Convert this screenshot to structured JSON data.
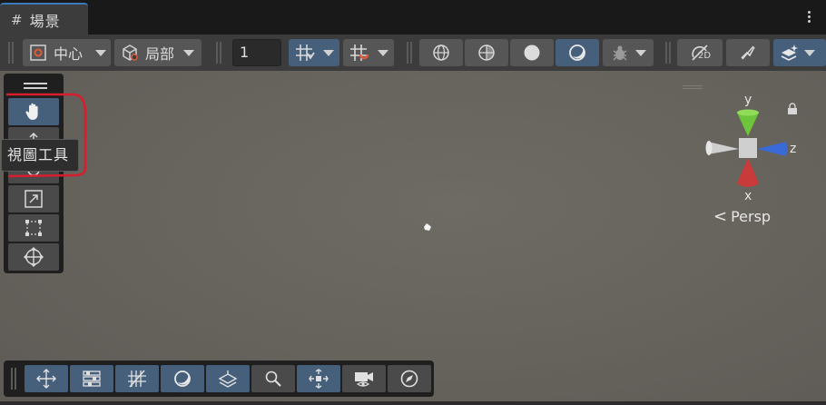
{
  "tab": {
    "icon": "grid-hash-icon",
    "title": "場景"
  },
  "toolbar": {
    "pivot_label": "中心",
    "space_label": "局部",
    "grid_step": "1"
  },
  "tooltip": {
    "text": "視圖工具"
  },
  "gizmo": {
    "y": "y",
    "x": "x",
    "z": "z",
    "projection": "Persp"
  },
  "colors": {
    "accent": "#46607c",
    "tab_accent": "#3a79bb",
    "annotation": "#d81e2e",
    "gizmo_y": "#6ec43a",
    "gizmo_x": "#c93a3a",
    "gizmo_z": "#3a6ad8"
  }
}
